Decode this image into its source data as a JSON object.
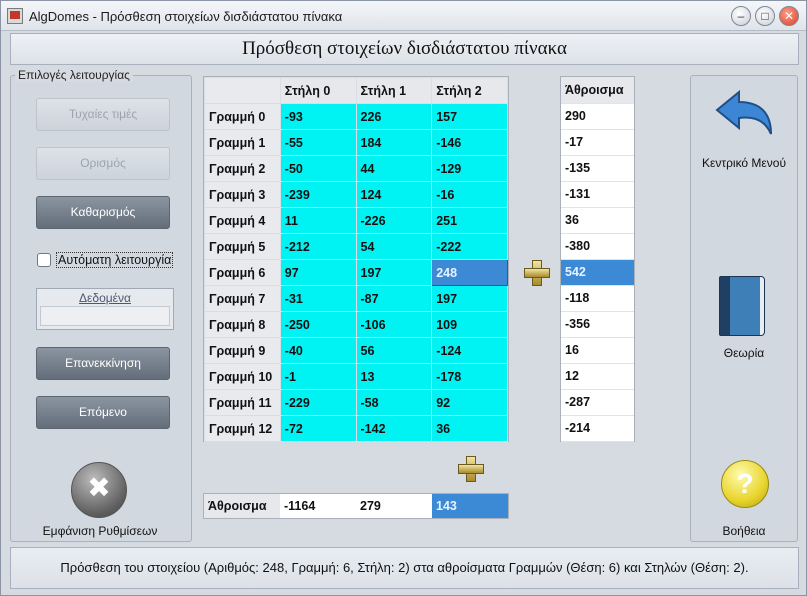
{
  "window": {
    "title": "AlgDomes - Πρόσθεση στοιχείων δισδιάστατου πίνακα",
    "close_symbol": "✕",
    "min_symbol": "–",
    "max_symbol": "□"
  },
  "header": {
    "title": "Πρόσθεση στοιχείων δισδιάστατου πίνακα"
  },
  "left_panel": {
    "title": "Επιλογές λειτουργίας",
    "buttons": {
      "random": "Τυχαίες τιμές",
      "define": "Ορισμός",
      "clear": "Καθαρισμός",
      "restart": "Επανεκκίνηση",
      "next": "Επόμενο"
    },
    "auto_mode_label": "Αυτόματη λειτουργία",
    "auto_mode_checked": false,
    "data_label": "Δεδομένα",
    "data_value": "",
    "settings_label": "Εμφάνιση Ρυθμίσεων",
    "settings_glyph": "✖"
  },
  "grid": {
    "columns": [
      "Στήλη 0",
      "Στήλη 1",
      "Στήλη 2"
    ],
    "rows": [
      {
        "label": "Γραμμή 0",
        "values": [
          "-93",
          "226",
          "157"
        ]
      },
      {
        "label": "Γραμμή 1",
        "values": [
          "-55",
          "184",
          "-146"
        ]
      },
      {
        "label": "Γραμμή 2",
        "values": [
          "-50",
          "44",
          "-129"
        ]
      },
      {
        "label": "Γραμμή 3",
        "values": [
          "-239",
          "124",
          "-16"
        ]
      },
      {
        "label": "Γραμμή 4",
        "values": [
          "11",
          "-226",
          "251"
        ]
      },
      {
        "label": "Γραμμή 5",
        "values": [
          "-212",
          "54",
          "-222"
        ]
      },
      {
        "label": "Γραμμή 6",
        "values": [
          "97",
          "197",
          "248"
        ]
      },
      {
        "label": "Γραμμή 7",
        "values": [
          "-31",
          "-87",
          "197"
        ]
      },
      {
        "label": "Γραμμή 8",
        "values": [
          "-250",
          "-106",
          "109"
        ]
      },
      {
        "label": "Γραμμή 9",
        "values": [
          "-40",
          "56",
          "-124"
        ]
      },
      {
        "label": "Γραμμή 10",
        "values": [
          "-1",
          "13",
          "-178"
        ]
      },
      {
        "label": "Γραμμή 11",
        "values": [
          "-229",
          "-58",
          "92"
        ]
      },
      {
        "label": "Γραμμή 12",
        "values": [
          "-72",
          "-142",
          "36"
        ]
      }
    ],
    "selected": {
      "row": 6,
      "col": 2
    }
  },
  "row_sums": {
    "header": "Άθροισμα",
    "values": [
      "290",
      "-17",
      "-135",
      "-131",
      "36",
      "-380",
      "542",
      "-118",
      "-356",
      "16",
      "12",
      "-287",
      "-214"
    ],
    "selected": 6
  },
  "col_sums": {
    "label": "Άθροισμα",
    "values": [
      "-1164",
      "279",
      "143"
    ],
    "selected": 2
  },
  "right_panel": {
    "main_menu": "Κεντρικό Μενού",
    "theory": "Θεωρία",
    "help": "Βοήθεια",
    "help_glyph": "?"
  },
  "status": {
    "text": "Πρόσθεση του στοιχείου (Αριθμός: 248, Γραμμή: 6, Στήλη: 2) στα αθροίσματα Γραμμών (Θέση: 6) και Στηλών (Θέση: 2)."
  },
  "colors": {
    "cell": "#00f3f3",
    "selected": "#3c8ad6",
    "dark_button": "#646e7a"
  }
}
